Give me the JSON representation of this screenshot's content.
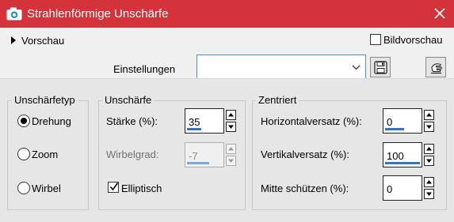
{
  "window": {
    "title": "Strahlenförmige Unschärfe",
    "icon": "camera-icon",
    "close_icon": "close-icon",
    "accent": "#d4333c"
  },
  "header": {
    "preview_toggle": "Vorschau",
    "preview_chevron_icon": "chevron-right-icon",
    "image_preview_label": "Bildvorschau",
    "image_preview_checked": false,
    "settings_label": "Einstellungen",
    "settings_value": "",
    "save_icon": "floppy-disk-icon",
    "reset_icon": "hand-pointer-icon"
  },
  "blur_type": {
    "title": "Unschärfetyp",
    "options": [
      {
        "label": "Drehung",
        "selected": true
      },
      {
        "label": "Zoom",
        "selected": false
      },
      {
        "label": "Wirbel",
        "selected": false
      }
    ]
  },
  "blur": {
    "title": "Unschärfe",
    "strength_label": "Stärke (%):",
    "strength_value": "35",
    "swirl_label": "Wirbelgrad:",
    "swirl_value": "-7",
    "swirl_enabled": false,
    "elliptical_label": "Elliptisch",
    "elliptical_checked": true
  },
  "centered": {
    "title": "Zentriert",
    "horizontal_label": "Horizontalversatz (%):",
    "horizontal_value": "0",
    "vertical_label": "Vertikalversatz (%):",
    "vertical_value": "100",
    "protect_label": "Mitte schützen (%):",
    "protect_value": "0"
  }
}
